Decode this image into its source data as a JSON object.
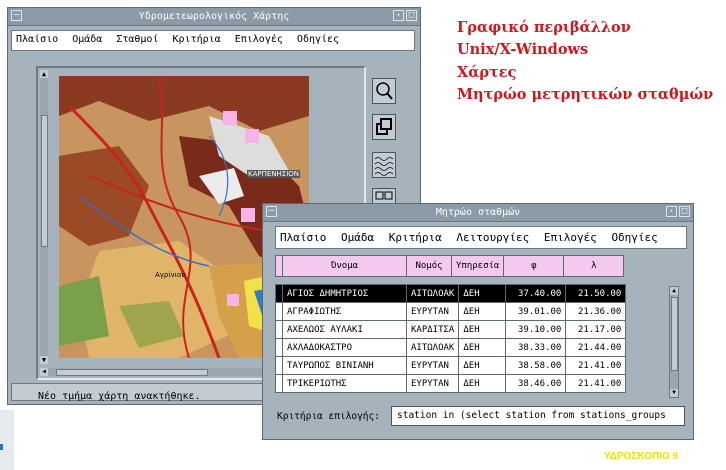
{
  "map_window": {
    "title": "Υδρομετεωρολογικός Χάρτης",
    "menu": [
      "Πλαίσιο",
      "Ομάδα",
      "Σταθμοί",
      "Κριτήρια",
      "Επιλογές",
      "Οδηγίες"
    ],
    "status": "Νέο τμήμα χάρτη ανακτήθηκε.",
    "map_label": "ΚΑΡΠΕΝΗΣΙΟΝ",
    "map_place": "Αγρίνιον",
    "tools": [
      "zoom-icon",
      "overlay-icon",
      "water-pattern-icon",
      "grid-icon"
    ]
  },
  "headline": [
    "Γραφικό περιβάλλον",
    "Unix/X-Windows",
    "Χάρτες",
    "Μητρώο μετρητικών σταθμών"
  ],
  "registry_window": {
    "title": "Μητρώο σταθμών",
    "menu": [
      "Πλαίσιο",
      "Ομάδα",
      "Κριτήρια",
      "Λειτουργίες",
      "Επιλογές",
      "Οδηγίες"
    ],
    "columns": [
      "Όνομα",
      "Νομός",
      "Υπηρεσία",
      "φ",
      "λ"
    ],
    "rows": [
      {
        "name": "ΑΓΙΟΣ ΔΗΜΗΤΡΙΟΣ",
        "prefecture": "ΑΙΤΩΛΟΑΚ",
        "service": "ΔΕΗ",
        "phi": "37.40.00",
        "lambda": "21.50.00",
        "selected": true
      },
      {
        "name": "ΑΓΡΑΦΙΩΤΗΣ",
        "prefecture": "ΕΥΡΥΤΑΝ",
        "service": "ΔΕΗ",
        "phi": "39.01.00",
        "lambda": "21.36.00",
        "selected": false
      },
      {
        "name": "ΑΧΕΛΩΟΣ ΑΥΛΑΚΙ",
        "prefecture": "ΚΑΡΔΙΤΣΑ",
        "service": "ΔΕΗ",
        "phi": "39.10.00",
        "lambda": "21.17.00",
        "selected": false
      },
      {
        "name": "ΑΧΛΑΔΟΚΑΣΤΡΟ",
        "prefecture": "ΑΙΤΩΛΟΑΚ",
        "service": "ΔΕΗ",
        "phi": "38.33.00",
        "lambda": "21.44.00",
        "selected": false
      },
      {
        "name": "ΤΑΥΡΩΠΟΣ ΒΙΝΙΑΝΗ",
        "prefecture": "ΕΥΡΥΤΑΝ",
        "service": "ΔΕΗ",
        "phi": "38.58.00",
        "lambda": "21.41.00",
        "selected": false
      },
      {
        "name": "ΤΡΙΚΕΡΙΩΤΗΣ",
        "prefecture": "ΕΥΡΥΤΑΝ",
        "service": "ΔΕΗ",
        "phi": "38.46.00",
        "lambda": "21.41.00",
        "selected": false
      }
    ],
    "criteria_label": "Κριτήρια επιλογής:",
    "criteria_value": "station in (select station from stations_groups"
  },
  "footer": "ΥΔΡΟΣΚΟΠΙΟ 9",
  "colors": {
    "headline": "#d2161c",
    "footer": "#f2e000",
    "window": "#a6b3bd",
    "header_row": "#f4c8ef"
  }
}
